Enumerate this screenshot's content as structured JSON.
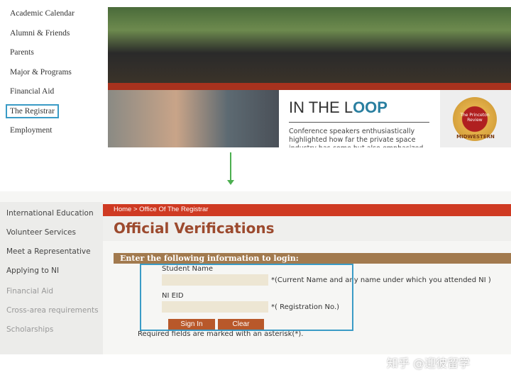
{
  "top_nav": [
    "Academic Calendar",
    "Alumni & Friends",
    "Parents",
    "Major & Programs",
    "Financial Aid",
    "The Registrar",
    "Employment"
  ],
  "banner": {
    "title_a": "IN THE L",
    "title_b": "OOP",
    "text": "Conference speakers enthusiastically highlighted how far the private space industry has come but also emphasized",
    "badge_text": "MIDWESTERN",
    "badge_inner": "The Princeton Review"
  },
  "sidebar": [
    "International Education",
    "Volunteer Services",
    "Meet a Representative",
    "Applying to NI",
    "Financial Aid",
    "Cross-area requirements",
    "Scholarships"
  ],
  "breadcrumb": "Home > Office Of The Registrar",
  "page_title": "Official Verifications",
  "form": {
    "header": "Enter the following information to login:",
    "name_label": "Student Name",
    "name_note": "*(Current Name and any name under which you attended NI )",
    "eid_label": "NI EID",
    "eid_note": "*( Registration No.)",
    "sign_in": "Sign In",
    "clear": "Clear",
    "required": "Required fields are marked with an asterisk(*)."
  },
  "watermark": "知乎 @迎彼留学"
}
